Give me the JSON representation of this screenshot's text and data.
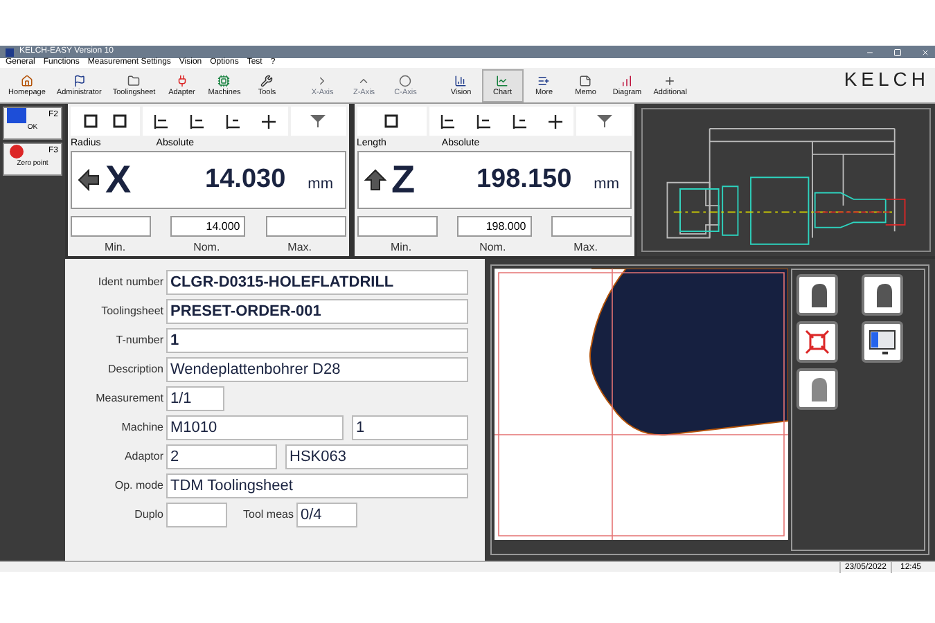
{
  "window": {
    "title": "KELCH-EASY Version 10"
  },
  "menu": [
    "General",
    "Functions",
    "Measurement Settings",
    "Vision",
    "Options",
    "Test",
    "?"
  ],
  "toolbar": [
    {
      "label": "Homepage",
      "disabled": false,
      "selected": false
    },
    {
      "label": "Administrator",
      "disabled": false,
      "selected": false
    },
    {
      "label": "Toolingsheet",
      "disabled": false,
      "selected": false
    },
    {
      "label": "Adapter",
      "disabled": false,
      "selected": false
    },
    {
      "label": "Machines",
      "disabled": false,
      "selected": false
    },
    {
      "label": "Tools",
      "disabled": false,
      "selected": false
    },
    {
      "label": "X-Axis",
      "disabled": true,
      "selected": false
    },
    {
      "label": "Z-Axis",
      "disabled": true,
      "selected": false
    },
    {
      "label": "C-Axis",
      "disabled": true,
      "selected": false
    },
    {
      "label": "Vision",
      "disabled": false,
      "selected": false
    },
    {
      "label": "Chart",
      "disabled": false,
      "selected": true
    },
    {
      "label": "More",
      "disabled": false,
      "selected": false
    },
    {
      "label": "Memo",
      "disabled": false,
      "selected": false
    },
    {
      "label": "Diagram",
      "disabled": false,
      "selected": false
    },
    {
      "label": "Additional",
      "disabled": false,
      "selected": false
    }
  ],
  "logo": "KELCH",
  "side_buttons": [
    {
      "key": "F2",
      "label": "OK"
    },
    {
      "key": "F3",
      "label": "Zero point"
    }
  ],
  "axes": [
    {
      "name": "Radius",
      "mode": "Absolute",
      "axis": "X",
      "value": "14.030",
      "unit": "mm",
      "nominal": "14.000",
      "min_label": "Min.",
      "nom_label": "Nom.",
      "max_label": "Max."
    },
    {
      "name": "Length",
      "mode": "Absolute",
      "axis": "Z",
      "value": "198.150",
      "unit": "mm",
      "nominal": "198.000",
      "min_label": "Min.",
      "nom_label": "Nom.",
      "max_label": "Max."
    }
  ],
  "form": [
    {
      "kind": "wide",
      "fields": [
        {
          "label": "Ident number",
          "value": "CLGR-D0315-HOLEFLATDRILL",
          "bold": true
        }
      ]
    },
    {
      "kind": "wide",
      "fields": [
        {
          "label": "Toolingsheet",
          "value": "PRESET-ORDER-001",
          "bold": true
        }
      ]
    },
    {
      "kind": "wide",
      "fields": [
        {
          "label": "T-number",
          "value": "1",
          "bold": true
        }
      ]
    },
    {
      "kind": "wide",
      "fields": [
        {
          "label": "Description",
          "value": "Wendeplattenbohrer D28",
          "bold": false
        }
      ]
    },
    {
      "kind": "short",
      "fields": [
        {
          "label": "Measurement",
          "value": "1/1",
          "bold": false
        }
      ]
    },
    {
      "kind": "pair",
      "fields": [
        {
          "label": "Machine",
          "value": "M1010",
          "bold": false
        },
        {
          "value": "1",
          "bold": false
        }
      ]
    },
    {
      "kind": "split",
      "fields": [
        {
          "label": "Adaptor",
          "value": "2",
          "bold": false
        },
        {
          "value": "HSK063",
          "bold": false
        }
      ]
    },
    {
      "kind": "wide",
      "fields": [
        {
          "label": "Op. mode",
          "value": "TDM Toolingsheet",
          "bold": false
        }
      ]
    },
    {
      "kind": "duo",
      "fields": [
        {
          "label": "Duplo"
        },
        {
          "label": "Tool meas",
          "value": "0/4",
          "bold": false
        }
      ]
    }
  ],
  "status_bar": {
    "date": "23/05/2022",
    "time": "12:45"
  }
}
